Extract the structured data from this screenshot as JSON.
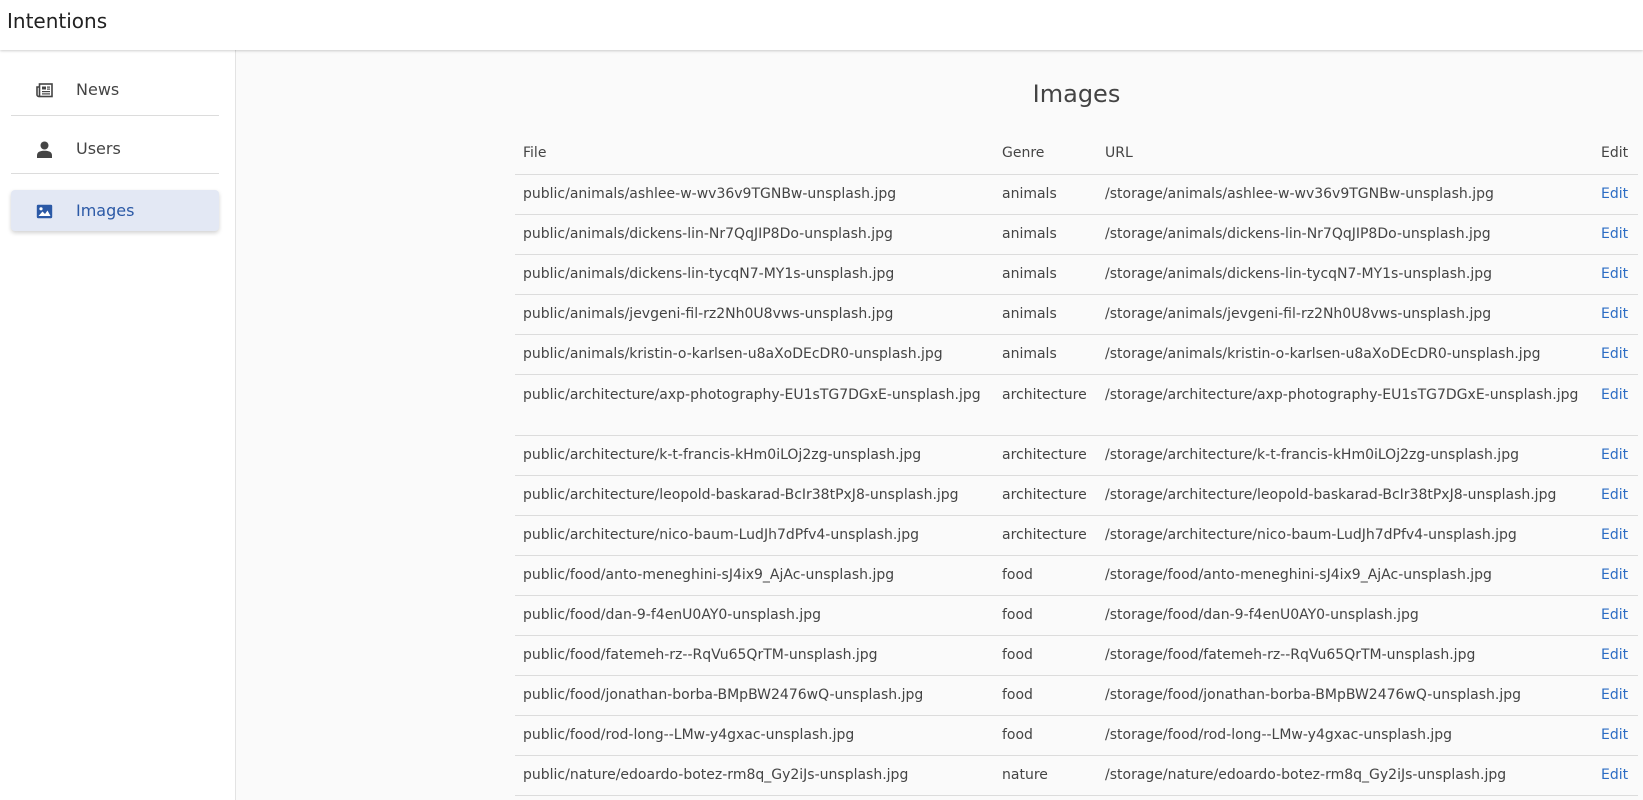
{
  "app": {
    "title": "Intentions"
  },
  "sidebar": {
    "items": [
      {
        "label": "News",
        "icon": "newspaper-icon",
        "active": false
      },
      {
        "label": "Users",
        "icon": "user-icon",
        "active": false
      },
      {
        "label": "Images",
        "icon": "image-icon",
        "active": true
      }
    ]
  },
  "page": {
    "title": "Images"
  },
  "table": {
    "headers": {
      "file": "File",
      "genre": "Genre",
      "url": "URL",
      "edit": "Edit"
    },
    "edit_label": "Edit",
    "rows": [
      {
        "file": "public/animals/ashlee-w-wv36v9TGNBw-unsplash.jpg",
        "genre": "animals",
        "url": "/storage/animals/ashlee-w-wv36v9TGNBw-unsplash.jpg"
      },
      {
        "file": "public/animals/dickens-lin-Nr7QqJIP8Do-unsplash.jpg",
        "genre": "animals",
        "url": "/storage/animals/dickens-lin-Nr7QqJIP8Do-unsplash.jpg"
      },
      {
        "file": "public/animals/dickens-lin-tycqN7-MY1s-unsplash.jpg",
        "genre": "animals",
        "url": "/storage/animals/dickens-lin-tycqN7-MY1s-unsplash.jpg"
      },
      {
        "file": "public/animals/jevgeni-fil-rz2Nh0U8vws-unsplash.jpg",
        "genre": "animals",
        "url": "/storage/animals/jevgeni-fil-rz2Nh0U8vws-unsplash.jpg"
      },
      {
        "file": "public/animals/kristin-o-karlsen-u8aXoDEcDR0-unsplash.jpg",
        "genre": "animals",
        "url": "/storage/animals/kristin-o-karlsen-u8aXoDEcDR0-unsplash.jpg"
      },
      {
        "file": "public/architecture/axp-photography-EU1sTG7DGxE-unsplash.jpg",
        "genre": "architecture",
        "url": "/storage/architecture/axp-photography-EU1sTG7DGxE-unsplash.jpg"
      },
      {
        "file": "public/architecture/k-t-francis-kHm0iLOj2zg-unsplash.jpg",
        "genre": "architecture",
        "url": "/storage/architecture/k-t-francis-kHm0iLOj2zg-unsplash.jpg"
      },
      {
        "file": "public/architecture/leopold-baskarad-BcIr38tPxJ8-unsplash.jpg",
        "genre": "architecture",
        "url": "/storage/architecture/leopold-baskarad-BcIr38tPxJ8-unsplash.jpg"
      },
      {
        "file": "public/architecture/nico-baum-LudJh7dPfv4-unsplash.jpg",
        "genre": "architecture",
        "url": "/storage/architecture/nico-baum-LudJh7dPfv4-unsplash.jpg"
      },
      {
        "file": "public/food/anto-meneghini-sJ4ix9_AjAc-unsplash.jpg",
        "genre": "food",
        "url": "/storage/food/anto-meneghini-sJ4ix9_AjAc-unsplash.jpg"
      },
      {
        "file": "public/food/dan-9-f4enU0AY0-unsplash.jpg",
        "genre": "food",
        "url": "/storage/food/dan-9-f4enU0AY0-unsplash.jpg"
      },
      {
        "file": "public/food/fatemeh-rz--RqVu65QrTM-unsplash.jpg",
        "genre": "food",
        "url": "/storage/food/fatemeh-rz--RqVu65QrTM-unsplash.jpg"
      },
      {
        "file": "public/food/jonathan-borba-BMpBW2476wQ-unsplash.jpg",
        "genre": "food",
        "url": "/storage/food/jonathan-borba-BMpBW2476wQ-unsplash.jpg"
      },
      {
        "file": "public/food/rod-long--LMw-y4gxac-unsplash.jpg",
        "genre": "food",
        "url": "/storage/food/rod-long--LMw-y4gxac-unsplash.jpg"
      },
      {
        "file": "public/nature/edoardo-botez-rm8q_Gy2iJs-unsplash.jpg",
        "genre": "nature",
        "url": "/storage/nature/edoardo-botez-rm8q_Gy2iJs-unsplash.jpg"
      }
    ]
  },
  "colors": {
    "accent": "#2b59a6",
    "link": "#2b6cc4",
    "active_bg": "#e3e8f4"
  }
}
